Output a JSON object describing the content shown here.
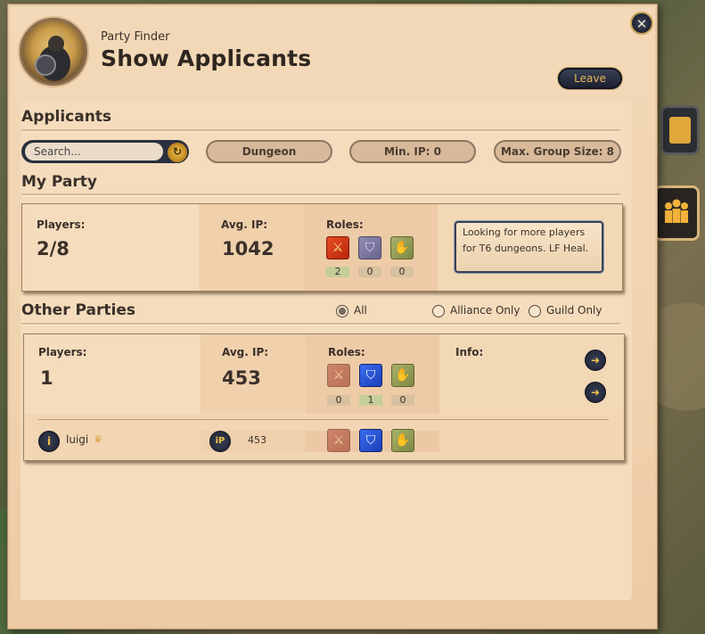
{
  "window": {
    "subtitle": "Party Finder",
    "title": "Show Applicants",
    "leave_label": "Leave",
    "close_glyph": "✕"
  },
  "applicants": {
    "heading": "Applicants",
    "search_placeholder": "Search...",
    "filter_activity": "Dungeon",
    "filter_min_ip": "Min. IP: 0",
    "filter_max_group": "Max. Group Size: 8"
  },
  "my_party": {
    "heading": "My Party",
    "players_label": "Players:",
    "players_value": "2/8",
    "avg_ip_label": "Avg. IP:",
    "avg_ip_value": "1042",
    "roles_label": "Roles:",
    "role_counts": [
      "2",
      "0",
      "0"
    ],
    "description": "Looking for more players for T6 dungeons. LF Heal."
  },
  "other_parties": {
    "heading": "Other Parties",
    "filters": [
      "All",
      "Alliance Only",
      "Guild Only"
    ],
    "selected_filter": "All",
    "parties": [
      {
        "players_label": "Players:",
        "players_value": "1",
        "avg_ip_label": "Avg. IP:",
        "avg_ip_value": "453",
        "roles_label": "Roles:",
        "role_counts": [
          "0",
          "1",
          "0"
        ],
        "info_label": "Info:",
        "members": [
          {
            "name": "luigi",
            "ip": "453",
            "is_leader": true
          }
        ]
      }
    ]
  },
  "icons": {
    "dps": "sword-icon",
    "tank": "shield-icon",
    "heal": "hand-icon",
    "info": "info-icon",
    "ip": "ip-icon",
    "leader": "crown-icon"
  },
  "colors": {
    "panel": "#f3d9b8",
    "button_dark": "#1c2030",
    "accent_gold": "#e7b85a"
  }
}
